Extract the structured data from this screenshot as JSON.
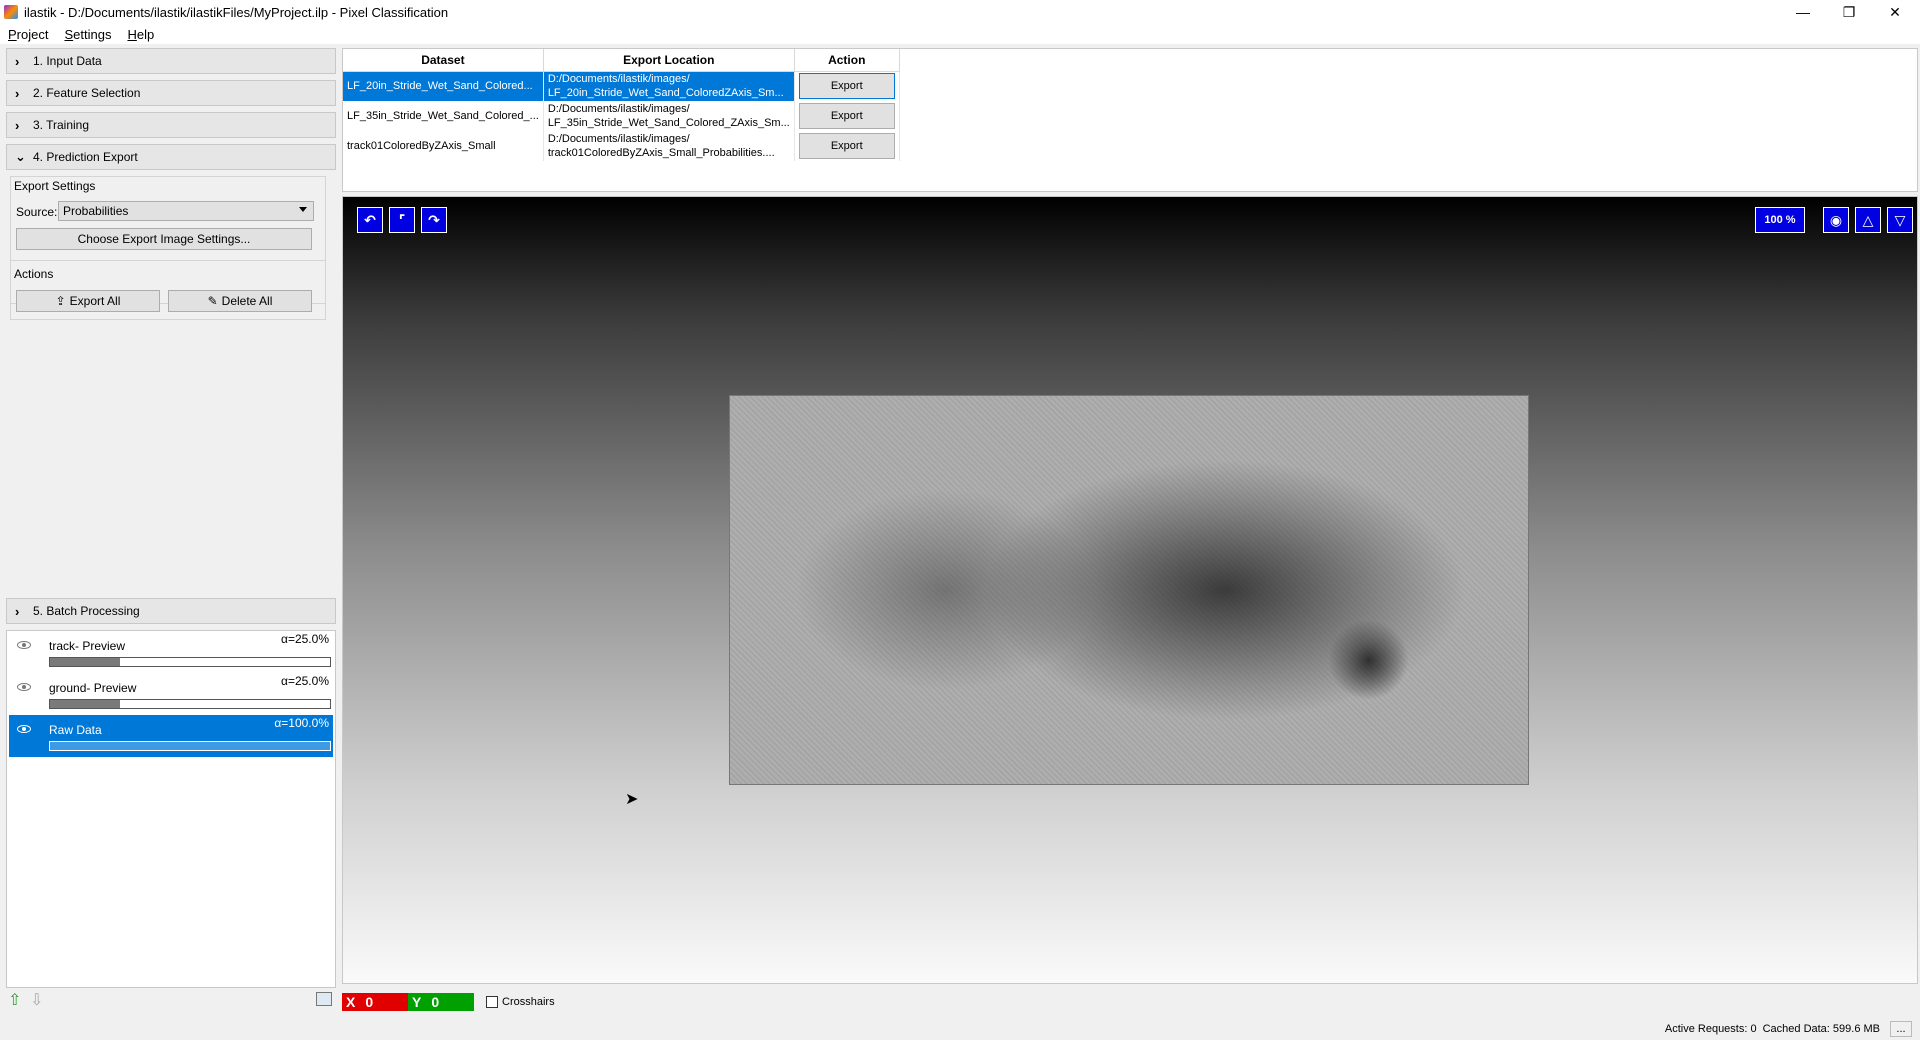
{
  "window": {
    "title": "ilastik - D:/Documents/ilastik/ilastikFiles/MyProject.ilp - Pixel Classification",
    "min_glyph": "—",
    "max_glyph": "❐",
    "close_glyph": "✕"
  },
  "menu": [
    "Project",
    "Settings",
    "Help"
  ],
  "applets": [
    {
      "label": "1. Input Data",
      "expanded": false
    },
    {
      "label": "2. Feature Selection",
      "expanded": false
    },
    {
      "label": "3. Training",
      "expanded": false
    },
    {
      "label": "4. Prediction Export",
      "expanded": true
    },
    {
      "label": "5. Batch Processing",
      "expanded": false
    }
  ],
  "chevrons": {
    "collapsed": "›",
    "expanded": "⌄"
  },
  "export_settings": {
    "group_title": "Export Settings",
    "source_label": "Source:",
    "source_value": "Probabilities",
    "choose_button": "Choose Export Image Settings..."
  },
  "actions": {
    "group_title": "Actions",
    "export_all": "Export All",
    "delete_all": "Delete All"
  },
  "layers": [
    {
      "name": "track- Preview",
      "alpha": "α=25.0%",
      "opacity": 0.25,
      "selected": false
    },
    {
      "name": "ground- Preview",
      "alpha": "α=25.0%",
      "opacity": 0.25,
      "selected": false
    },
    {
      "name": "Raw Data",
      "alpha": "α=100.0%",
      "opacity": 1.0,
      "selected": true
    }
  ],
  "table": {
    "headers": [
      "Dataset",
      "Export Location",
      "Action"
    ],
    "rows": [
      {
        "dataset": "LF_20in_Stride_Wet_Sand_Colored...",
        "loc1": "D:/Documents/ilastik/images/",
        "loc2": "LF_20in_Stride_Wet_Sand_ColoredZAxis_Sm...",
        "action": "Export",
        "selected": true
      },
      {
        "dataset": "LF_35in_Stride_Wet_Sand_Colored_...",
        "loc1": "D:/Documents/ilastik/images/",
        "loc2": "LF_35in_Stride_Wet_Sand_Colored_ZAxis_Sm...",
        "action": "Export",
        "selected": false
      },
      {
        "dataset": "track01ColoredByZAxis_Small",
        "loc1": "D:/Documents/ilastik/images/",
        "loc2": "track01ColoredByZAxis_Small_Probabilities....",
        "action": "Export",
        "selected": false
      }
    ]
  },
  "viewer": {
    "zoom": "100 %",
    "undo_glyph": "↶",
    "fit_glyph": "⌜",
    "redo_glyph": "↷",
    "snapshot_glyph": "◉",
    "up_glyph": "△",
    "down_glyph": "▽"
  },
  "coords": {
    "x_label": "X",
    "x_value": "0",
    "y_label": "Y",
    "y_value": "0",
    "crosshairs": "Crosshairs"
  },
  "status": {
    "requests": "Active Requests: 0",
    "cached": "Cached Data: 599.6 MB",
    "more": "..."
  },
  "colors": {
    "accent": "#0078d7",
    "tool_blue": "#0000e0",
    "x_red": "#e00000",
    "y_green": "#00a000"
  }
}
